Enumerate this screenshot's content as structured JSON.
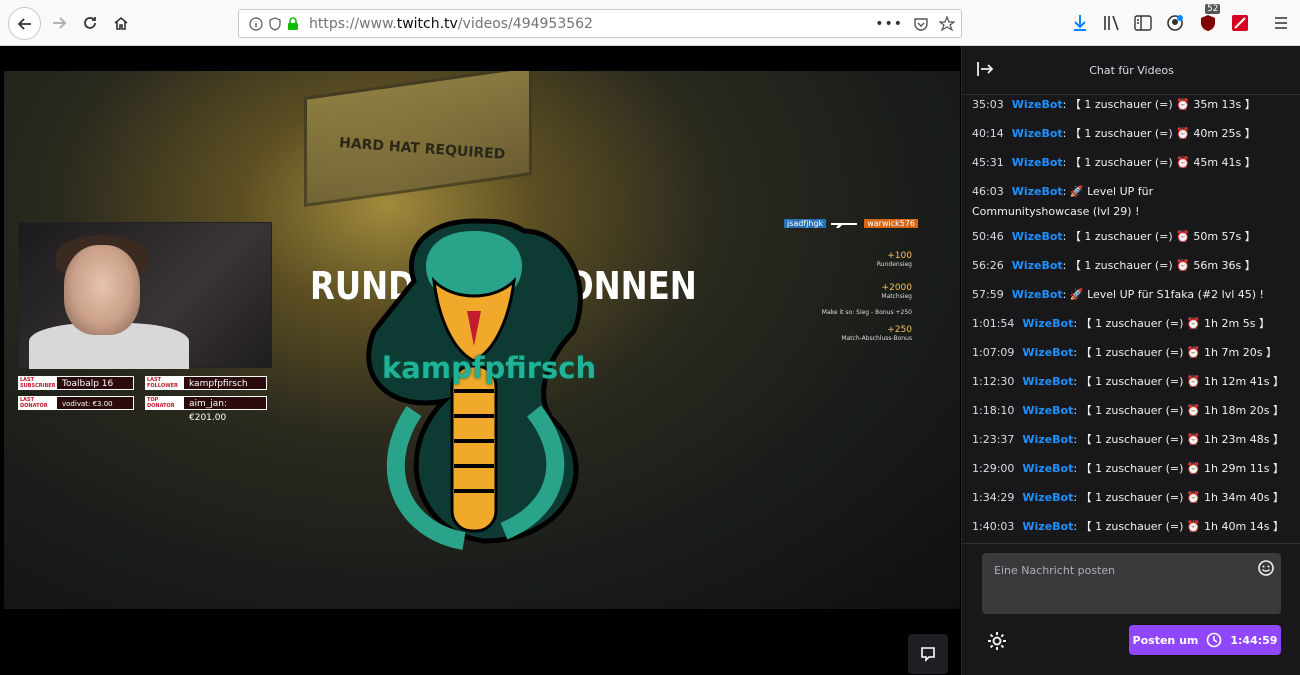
{
  "browser": {
    "url_prefix": "https://www.",
    "url_domain": "twitch.tv",
    "url_path": "/videos/494953562",
    "badge_count": "52"
  },
  "video": {
    "overlay_title": "RUNDE 9 GEWONNEN",
    "logo_name": "kampfpfirsch",
    "sign_text": "HARD HAT REQUIRED",
    "stats": [
      {
        "tag": "LAST SUBSCRIBER",
        "value": "Toalbalp 16"
      },
      {
        "tag": "LAST FOLLOWER",
        "value": "kampfpfirsch"
      },
      {
        "tag": "LAST DONATOR",
        "value": "vodivat: €3.00"
      },
      {
        "tag": "TOP DONATOR",
        "value": "aim_jan: €201.00"
      }
    ],
    "killfeed": {
      "left": "jsadfjhgk",
      "right": "warwick576"
    },
    "scores": [
      {
        "value": "+100",
        "label": "Rundensieg"
      },
      {
        "value": "+2000",
        "label": "Matchsieg"
      },
      {
        "value": "",
        "label": "Make it so: Sieg - Bonus +250"
      },
      {
        "value": "+250",
        "label": "Match-Abschluss-Bonus"
      }
    ]
  },
  "chat": {
    "header_title": "Chat für Videos",
    "messages": [
      {
        "ts": "35:03",
        "user": "WizeBot",
        "text": "【 1 zuschauer (=) ⏰ 35m 13s 】"
      },
      {
        "ts": "40:14",
        "user": "WizeBot",
        "text": "【 1 zuschauer (=) ⏰ 40m 25s 】"
      },
      {
        "ts": "45:31",
        "user": "WizeBot",
        "text": "【 1 zuschauer (=) ⏰ 45m 41s 】"
      },
      {
        "ts": "46:03",
        "user": "WizeBot",
        "text": "🚀 Level UP für Communityshowcase (lvl 29) !"
      },
      {
        "ts": "50:46",
        "user": "WizeBot",
        "text": "【 1 zuschauer (=) ⏰ 50m 57s 】"
      },
      {
        "ts": "56:26",
        "user": "WizeBot",
        "text": "【 1 zuschauer (=) ⏰ 56m 36s 】"
      },
      {
        "ts": "57:59",
        "user": "WizeBot",
        "text": "🚀 Level UP für S1faka (#2 lvl 45) !"
      },
      {
        "ts": "1:01:54",
        "user": "WizeBot",
        "text": "【 1 zuschauer (=) ⏰ 1h 2m 5s 】"
      },
      {
        "ts": "1:07:09",
        "user": "WizeBot",
        "text": "【 1 zuschauer (=) ⏰ 1h 7m 20s 】"
      },
      {
        "ts": "1:12:30",
        "user": "WizeBot",
        "text": "【 1 zuschauer (=) ⏰ 1h 12m 41s 】"
      },
      {
        "ts": "1:18:10",
        "user": "WizeBot",
        "text": "【 1 zuschauer (=) ⏰ 1h 18m 20s 】"
      },
      {
        "ts": "1:23:37",
        "user": "WizeBot",
        "text": "【 1 zuschauer (=) ⏰ 1h 23m 48s 】"
      },
      {
        "ts": "1:29:00",
        "user": "WizeBot",
        "text": "【 1 zuschauer (=) ⏰ 1h 29m 11s 】"
      },
      {
        "ts": "1:34:29",
        "user": "WizeBot",
        "text": "【 1 zuschauer (=) ⏰ 1h 34m 40s 】"
      },
      {
        "ts": "1:40:03",
        "user": "WizeBot",
        "text": "【 1 zuschauer (=) ⏰ 1h 40m 14s 】"
      }
    ],
    "input_placeholder": "Eine Nachricht posten",
    "post_label": "Posten um",
    "post_time": "1:44:59"
  },
  "colors": {
    "accent": "#9147ff",
    "username": "#1e90ff",
    "chat_bg": "#18181b"
  }
}
